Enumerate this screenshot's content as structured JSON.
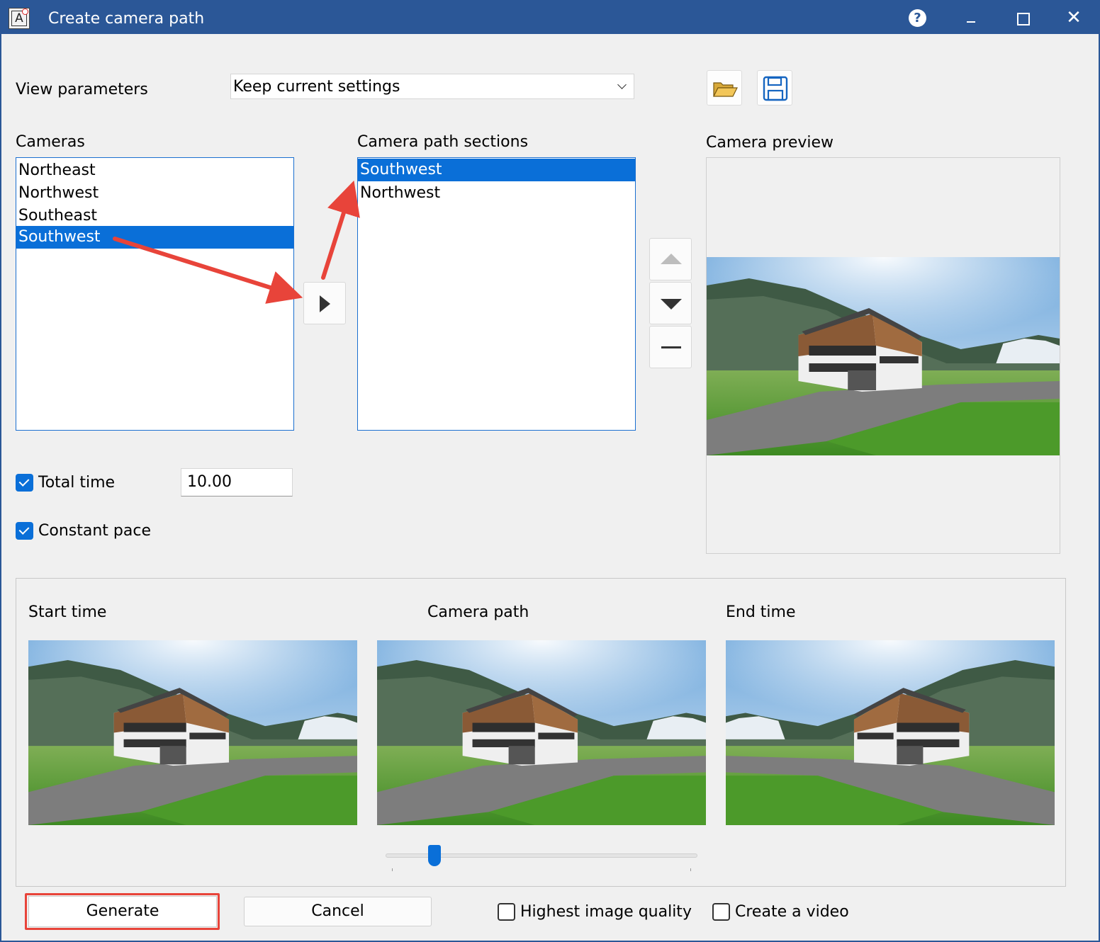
{
  "window": {
    "title": "Create camera path",
    "app_icon_letter": "A",
    "help_symbol": "?",
    "close_symbol": "✕"
  },
  "view_parameters": {
    "label": "View parameters",
    "selected": "Keep current settings"
  },
  "toolbar": {
    "open_icon": "folder-open-icon",
    "save_icon": "save-icon"
  },
  "cameras": {
    "label": "Cameras",
    "items": [
      "Northeast",
      "Northwest",
      "Southeast",
      "Southwest"
    ],
    "selected": "Southwest"
  },
  "camera_path_sections": {
    "label": "Camera path sections",
    "items": [
      "Southwest",
      "Northwest"
    ],
    "selected": "Southwest"
  },
  "camera_preview": {
    "label": "Camera preview"
  },
  "options": {
    "total_time_label": "Total time",
    "total_time_checked": true,
    "total_time_value": "10.00",
    "constant_pace_label": "Constant pace",
    "constant_pace_checked": true
  },
  "timeline": {
    "start_label": "Start time",
    "path_label": "Camera path",
    "end_label": "End time",
    "slider_position": 0.14
  },
  "footer": {
    "generate_label": "Generate",
    "cancel_label": "Cancel",
    "highest_quality_label": "Highest image quality",
    "highest_quality_checked": false,
    "create_video_label": "Create a video",
    "create_video_checked": false
  },
  "colors": {
    "titlebar": "#2b5797",
    "selection": "#0a6fd8",
    "annotation_arrow": "#e8443a"
  }
}
